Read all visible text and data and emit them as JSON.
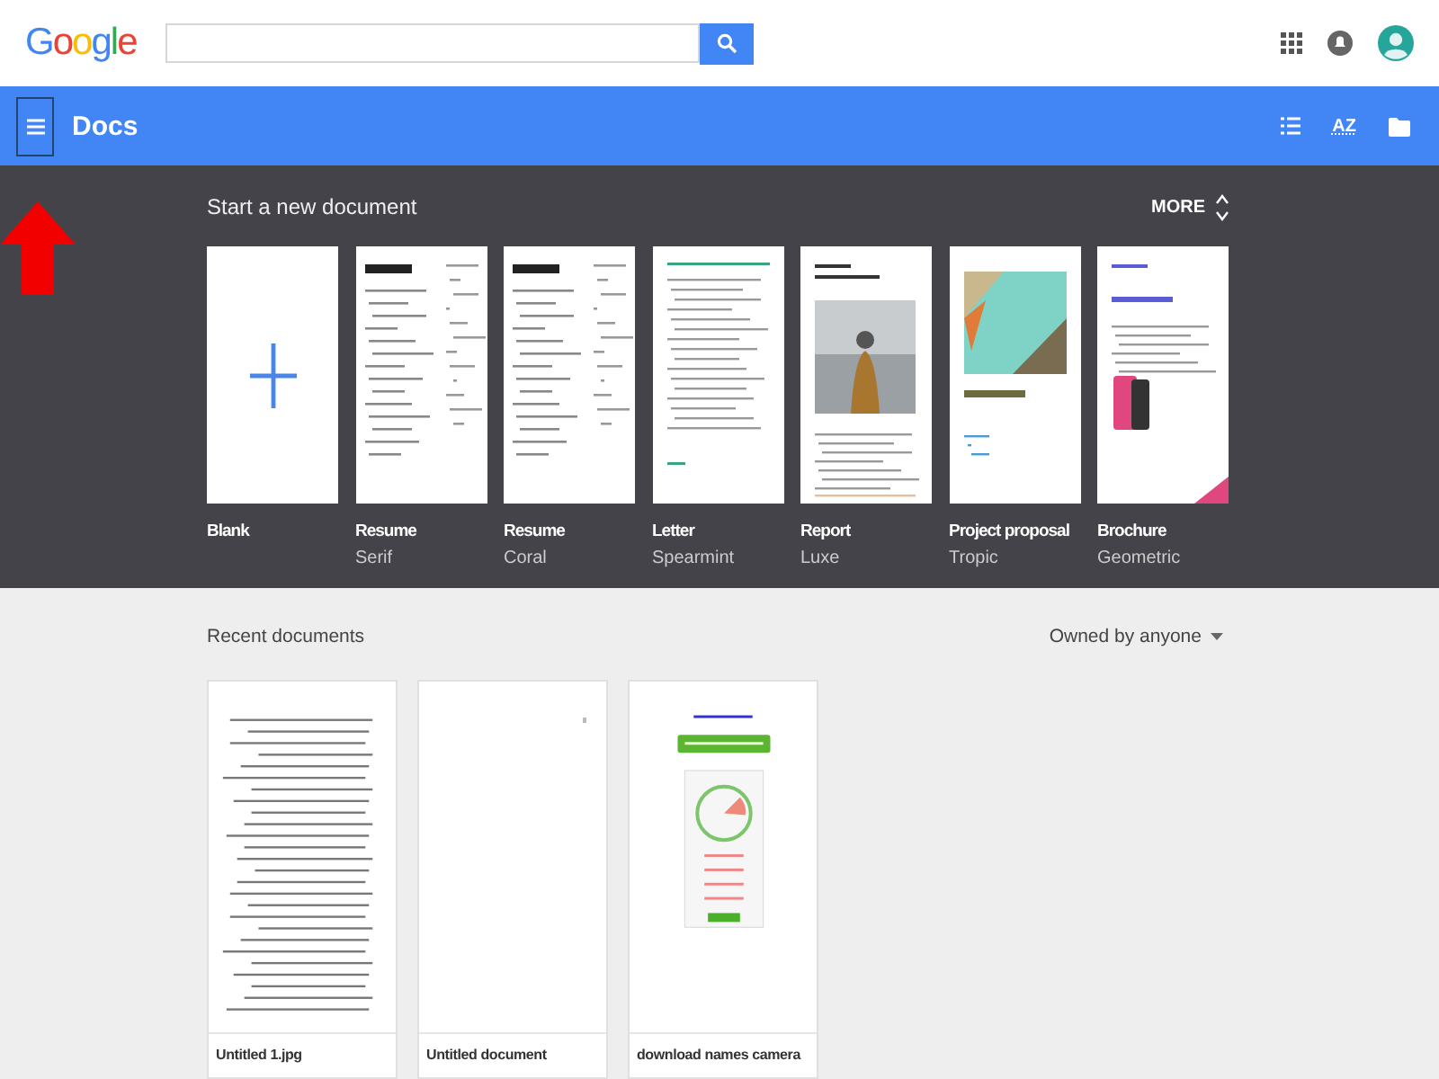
{
  "header": {
    "logo": "Google"
  },
  "appbar": {
    "title": "Docs",
    "sort_label": "AZ"
  },
  "templates": {
    "title": "Start a new document",
    "more": "MORE",
    "items": [
      {
        "kind": "blank",
        "name": "Blank"
      },
      {
        "kind": "resume",
        "name": "Resume",
        "style": "Serif"
      },
      {
        "kind": "resume",
        "name": "Resume",
        "style": "Coral"
      },
      {
        "kind": "letter",
        "name": "Letter",
        "style": "Spearmint"
      },
      {
        "kind": "report",
        "name": "Report",
        "style": "Luxe"
      },
      {
        "kind": "proposal",
        "name": "Project proposal",
        "style": "Tropic"
      },
      {
        "kind": "brochure",
        "name": "Brochure",
        "style": "Geometric"
      }
    ]
  },
  "recent": {
    "title": "Recent documents",
    "owner_filter": "Owned by anyone",
    "documents": [
      {
        "kind": "text",
        "name": "Untitled 1.jpg"
      },
      {
        "kind": "empty",
        "name": "Untitled document"
      },
      {
        "kind": "web",
        "name": "download names camera"
      }
    ]
  }
}
